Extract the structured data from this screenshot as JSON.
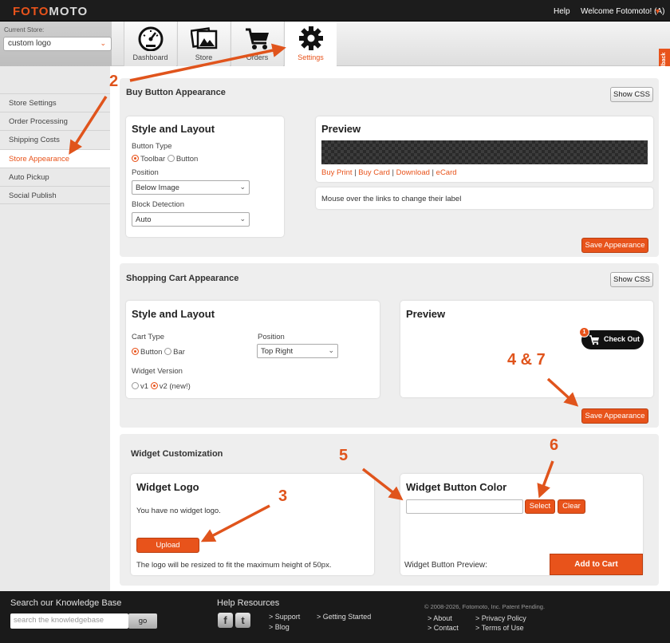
{
  "topbar": {
    "logo_part1": "FOTO",
    "logo_part2": "MOTO",
    "help": "Help",
    "welcome": "Welcome Fotomoto! (A)"
  },
  "store": {
    "label": "Current Store:",
    "value": "custom logo"
  },
  "tabs": [
    {
      "label": "Dashboard",
      "icon": "speedometer-icon"
    },
    {
      "label": "Store",
      "icon": "photos-icon"
    },
    {
      "label": "Orders",
      "icon": "cart-icon"
    },
    {
      "label": "Settings",
      "icon": "gear-icon",
      "active": true
    }
  ],
  "feedback": "Feedback",
  "sidebar": {
    "items": [
      {
        "label": "Store Settings"
      },
      {
        "label": "Order Processing"
      },
      {
        "label": "Shipping Costs"
      },
      {
        "label": "Store Appearance",
        "active": true
      },
      {
        "label": "Auto Pickup"
      },
      {
        "label": "Social Publish"
      }
    ]
  },
  "buy_button": {
    "title": "Buy Button Appearance",
    "show_css": "Show CSS",
    "style_title": "Style and Layout",
    "button_type_label": "Button Type",
    "opt_toolbar": "Toolbar",
    "opt_button": "Button",
    "position_label": "Position",
    "position_value": "Below Image",
    "block_label": "Block Detection",
    "block_value": "Auto",
    "preview_title": "Preview",
    "link_buy_print": "Buy Print",
    "link_buy_card": "Buy Card",
    "link_download": "Download",
    "link_ecard": "eCard",
    "sep": "|",
    "hint": "Mouse over the links to change their label",
    "save": "Save Appearance"
  },
  "cart": {
    "title": "Shopping Cart Appearance",
    "show_css": "Show CSS",
    "style_title": "Style and Layout",
    "cart_type_label": "Cart Type",
    "opt_button": "Button",
    "opt_bar": "Bar",
    "position_label": "Position",
    "position_value": "Top Right",
    "widget_version_label": "Widget Version",
    "opt_v1": "v1",
    "opt_v2": "v2 (new!)",
    "preview_title": "Preview",
    "checkout_label": "Check Out",
    "checkout_badge": "1",
    "save": "Save Appearance"
  },
  "widget": {
    "title": "Widget Customization",
    "logo_title": "Widget Logo",
    "no_logo": "You have no widget logo.",
    "upload": "Upload",
    "resize_note": "The logo will be resized to fit the maximum height of 50px.",
    "color_title": "Widget Button Color",
    "color_value": "",
    "select": "Select",
    "clear": "Clear",
    "preview_label": "Widget Button Preview:",
    "add_to_cart": "Add to Cart"
  },
  "footer": {
    "search_title": "Search our Knowledge Base",
    "search_placeholder": "search the knowledgebase",
    "go": "go",
    "help_title": "Help Resources",
    "facebook": "f",
    "twitter": "t",
    "support": "Support",
    "blog": "Blog",
    "getting_started": "Getting Started",
    "copyright": "© 2008-2026, Fotomoto, Inc. Patent Pending.",
    "about": "About",
    "contact": "Contact",
    "privacy": "Privacy Policy",
    "terms": "Terms of Use",
    "arrow": ">"
  },
  "annotations": {
    "n2": "2",
    "n3": "3",
    "n47": "4 & 7",
    "n5": "5",
    "n6": "6",
    "color": "#e0541c"
  },
  "colors": {
    "accent": "#e8531b",
    "topbar": "#1c1c1c",
    "footer": "#1a1a1a"
  }
}
